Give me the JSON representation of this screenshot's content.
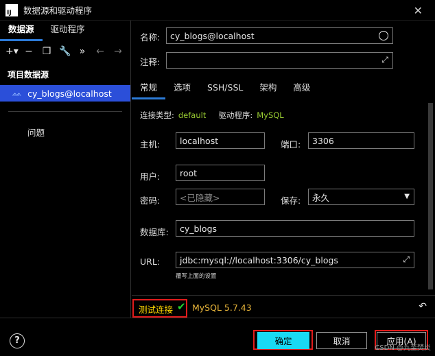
{
  "window": {
    "title": "数据源和驱动程序",
    "app_icon": "IJ"
  },
  "left": {
    "tabs": [
      "数据源",
      "驱动程序"
    ],
    "section": "项目数据源",
    "datasource": "cy_blogs@localhost",
    "problems": "问题"
  },
  "form": {
    "name_label": "名称:",
    "name_value": "cy_blogs@localhost",
    "comment_label": "注释:",
    "comment_value": ""
  },
  "tabs": [
    "常规",
    "选项",
    "SSH/SSL",
    "架构",
    "高级"
  ],
  "general": {
    "conn_type_label": "连接类型:",
    "conn_type_value": "default",
    "driver_label": "驱动程序:",
    "driver_value": "MySQL",
    "host_label": "主机:",
    "host_value": "localhost",
    "port_label": "端口:",
    "port_value": "3306",
    "user_label": "用户:",
    "user_value": "root",
    "password_label": "密码:",
    "password_placeholder": "<已隐藏>",
    "save_label": "保存:",
    "save_value": "永久",
    "database_label": "数据库:",
    "database_value": "cy_blogs",
    "url_label": "URL:",
    "url_value": "jdbc:mysql://localhost:3306/cy_blogs",
    "url_hint": "覆写上面的设置"
  },
  "bottom": {
    "test_connection": "测试连接",
    "mysql_version": "MySQL 5.7.43"
  },
  "footer": {
    "ok": "确定",
    "cancel": "取消",
    "apply": "应用(A)"
  },
  "watermark": "CSDN @九至焚炎",
  "colors": {
    "accent": "#2c7bd8",
    "selection": "#2b4fd9",
    "primary_button": "#19d9f4",
    "highlight_box": "#e21b1b",
    "status_ok": "#22d32e",
    "link": "#ffd700"
  }
}
